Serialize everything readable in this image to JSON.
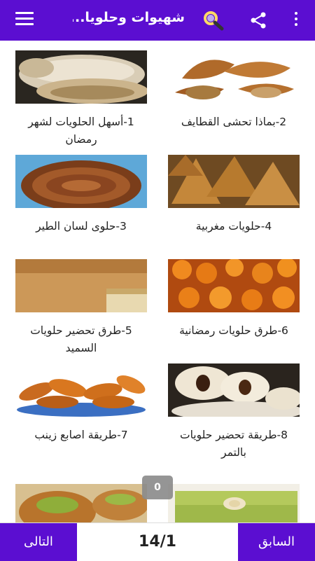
{
  "app": {
    "title": "شهيوات وحلويا..."
  },
  "icons": {
    "menu": "hamburger-menu-icon",
    "search": "search-icon",
    "share": "share-icon",
    "more": "more-vertical-icon"
  },
  "colors": {
    "primary": "#5b0ed1",
    "badge": "#8a8a8a"
  },
  "items": [
    {
      "label": "1-أسهل الحلويات لشهر رمضان",
      "image": "pastry-food-photo"
    },
    {
      "label": "2-بماذا تحشى القطايف",
      "image": "qatayef-food-photo"
    },
    {
      "label": "3-حلوى لسان الطير",
      "image": "bird-tongue-sweets-photo"
    },
    {
      "label": "4-حلويات مغربية",
      "image": "moroccan-sweets-photo"
    },
    {
      "label": "5-طرق تحضير حلويات السميد",
      "image": "semolina-cake-photo"
    },
    {
      "label": "6-طرق حلويات رمضانية",
      "image": "fried-dough-balls-photo"
    },
    {
      "label": "7-طريقة اصابع زينب",
      "image": "zainab-fingers-photo"
    },
    {
      "label": "8-طريقة تحضير حلويات بالتمر",
      "image": "date-cookies-photo"
    },
    {
      "label": "",
      "image": "pistachio-dessert-photo"
    },
    {
      "label": "",
      "image": "pistachio-cake-photo"
    }
  ],
  "badge": {
    "count": "0"
  },
  "pagination": {
    "next_label": "التالى",
    "prev_label": "السابق",
    "indicator": "14/1"
  }
}
